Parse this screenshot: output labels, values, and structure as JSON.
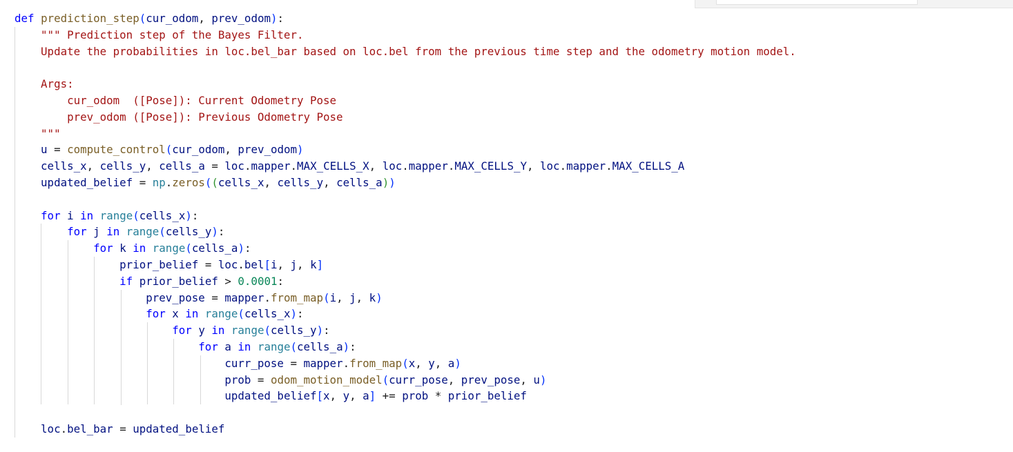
{
  "code_lines": [
    [
      [
        "kw",
        "def"
      ],
      [
        "pn",
        " "
      ],
      [
        "fn",
        "prediction_step"
      ],
      [
        "br1",
        "("
      ],
      [
        "var",
        "cur_odom"
      ],
      [
        "pn",
        ", "
      ],
      [
        "var",
        "prev_odom"
      ],
      [
        "br1",
        ")"
      ],
      [
        "pn",
        ":"
      ]
    ],
    [
      [
        "pn",
        "    "
      ],
      [
        "str",
        "\"\"\" Prediction step of the Bayes Filter."
      ]
    ],
    [
      [
        "str",
        "    Update the probabilities in loc.bel_bar based on loc.bel from the previous time step and the odometry motion model."
      ]
    ],
    [],
    [
      [
        "str",
        "    Args:"
      ]
    ],
    [
      [
        "str",
        "        cur_odom  ([Pose]): Current Odometry Pose"
      ]
    ],
    [
      [
        "str",
        "        prev_odom ([Pose]): Previous Odometry Pose"
      ]
    ],
    [
      [
        "str",
        "    \"\"\""
      ]
    ],
    [
      [
        "pn",
        "    "
      ],
      [
        "var",
        "u"
      ],
      [
        "op",
        " = "
      ],
      [
        "fn",
        "compute_control"
      ],
      [
        "br1",
        "("
      ],
      [
        "var",
        "cur_odom"
      ],
      [
        "pn",
        ", "
      ],
      [
        "var",
        "prev_odom"
      ],
      [
        "br1",
        ")"
      ]
    ],
    [
      [
        "pn",
        "    "
      ],
      [
        "var",
        "cells_x"
      ],
      [
        "pn",
        ", "
      ],
      [
        "var",
        "cells_y"
      ],
      [
        "pn",
        ", "
      ],
      [
        "var",
        "cells_a"
      ],
      [
        "op",
        " = "
      ],
      [
        "var",
        "loc"
      ],
      [
        "pn",
        "."
      ],
      [
        "var",
        "mapper"
      ],
      [
        "pn",
        "."
      ],
      [
        "var",
        "MAX_CELLS_X"
      ],
      [
        "pn",
        ", "
      ],
      [
        "var",
        "loc"
      ],
      [
        "pn",
        "."
      ],
      [
        "var",
        "mapper"
      ],
      [
        "pn",
        "."
      ],
      [
        "var",
        "MAX_CELLS_Y"
      ],
      [
        "pn",
        ", "
      ],
      [
        "var",
        "loc"
      ],
      [
        "pn",
        "."
      ],
      [
        "var",
        "mapper"
      ],
      [
        "pn",
        "."
      ],
      [
        "var",
        "MAX_CELLS_A"
      ]
    ],
    [
      [
        "pn",
        "    "
      ],
      [
        "var",
        "updated_belief"
      ],
      [
        "op",
        " = "
      ],
      [
        "mod",
        "np"
      ],
      [
        "pn",
        "."
      ],
      [
        "fn",
        "zeros"
      ],
      [
        "br1",
        "("
      ],
      [
        "br2",
        "("
      ],
      [
        "var",
        "cells_x"
      ],
      [
        "pn",
        ", "
      ],
      [
        "var",
        "cells_y"
      ],
      [
        "pn",
        ", "
      ],
      [
        "var",
        "cells_a"
      ],
      [
        "br2",
        ")"
      ],
      [
        "br1",
        ")"
      ]
    ],
    [],
    [
      [
        "pn",
        "    "
      ],
      [
        "kw",
        "for"
      ],
      [
        "pn",
        " "
      ],
      [
        "var",
        "i"
      ],
      [
        "pn",
        " "
      ],
      [
        "kw",
        "in"
      ],
      [
        "pn",
        " "
      ],
      [
        "mod",
        "range"
      ],
      [
        "br1",
        "("
      ],
      [
        "var",
        "cells_x"
      ],
      [
        "br1",
        ")"
      ],
      [
        "pn",
        ":"
      ]
    ],
    [
      [
        "pn",
        "        "
      ],
      [
        "kw",
        "for"
      ],
      [
        "pn",
        " "
      ],
      [
        "var",
        "j"
      ],
      [
        "pn",
        " "
      ],
      [
        "kw",
        "in"
      ],
      [
        "pn",
        " "
      ],
      [
        "mod",
        "range"
      ],
      [
        "br1",
        "("
      ],
      [
        "var",
        "cells_y"
      ],
      [
        "br1",
        ")"
      ],
      [
        "pn",
        ":"
      ]
    ],
    [
      [
        "pn",
        "            "
      ],
      [
        "kw",
        "for"
      ],
      [
        "pn",
        " "
      ],
      [
        "var",
        "k"
      ],
      [
        "pn",
        " "
      ],
      [
        "kw",
        "in"
      ],
      [
        "pn",
        " "
      ],
      [
        "mod",
        "range"
      ],
      [
        "br1",
        "("
      ],
      [
        "var",
        "cells_a"
      ],
      [
        "br1",
        ")"
      ],
      [
        "pn",
        ":"
      ]
    ],
    [
      [
        "pn",
        "                "
      ],
      [
        "var",
        "prior_belief"
      ],
      [
        "op",
        " = "
      ],
      [
        "var",
        "loc"
      ],
      [
        "pn",
        "."
      ],
      [
        "var",
        "bel"
      ],
      [
        "br1",
        "["
      ],
      [
        "var",
        "i"
      ],
      [
        "pn",
        ", "
      ],
      [
        "var",
        "j"
      ],
      [
        "pn",
        ", "
      ],
      [
        "var",
        "k"
      ],
      [
        "br1",
        "]"
      ]
    ],
    [
      [
        "pn",
        "                "
      ],
      [
        "kw",
        "if"
      ],
      [
        "pn",
        " "
      ],
      [
        "var",
        "prior_belief"
      ],
      [
        "op",
        " > "
      ],
      [
        "num",
        "0.0001"
      ],
      [
        "pn",
        ":"
      ]
    ],
    [
      [
        "pn",
        "                    "
      ],
      [
        "var",
        "prev_pose"
      ],
      [
        "op",
        " = "
      ],
      [
        "var",
        "mapper"
      ],
      [
        "pn",
        "."
      ],
      [
        "fn",
        "from_map"
      ],
      [
        "br1",
        "("
      ],
      [
        "var",
        "i"
      ],
      [
        "pn",
        ", "
      ],
      [
        "var",
        "j"
      ],
      [
        "pn",
        ", "
      ],
      [
        "var",
        "k"
      ],
      [
        "br1",
        ")"
      ]
    ],
    [
      [
        "pn",
        "                    "
      ],
      [
        "kw",
        "for"
      ],
      [
        "pn",
        " "
      ],
      [
        "var",
        "x"
      ],
      [
        "pn",
        " "
      ],
      [
        "kw",
        "in"
      ],
      [
        "pn",
        " "
      ],
      [
        "mod",
        "range"
      ],
      [
        "br1",
        "("
      ],
      [
        "var",
        "cells_x"
      ],
      [
        "br1",
        ")"
      ],
      [
        "pn",
        ":"
      ]
    ],
    [
      [
        "pn",
        "                        "
      ],
      [
        "kw",
        "for"
      ],
      [
        "pn",
        " "
      ],
      [
        "var",
        "y"
      ],
      [
        "pn",
        " "
      ],
      [
        "kw",
        "in"
      ],
      [
        "pn",
        " "
      ],
      [
        "mod",
        "range"
      ],
      [
        "br1",
        "("
      ],
      [
        "var",
        "cells_y"
      ],
      [
        "br1",
        ")"
      ],
      [
        "pn",
        ":"
      ]
    ],
    [
      [
        "pn",
        "                            "
      ],
      [
        "kw",
        "for"
      ],
      [
        "pn",
        " "
      ],
      [
        "var",
        "a"
      ],
      [
        "pn",
        " "
      ],
      [
        "kw",
        "in"
      ],
      [
        "pn",
        " "
      ],
      [
        "mod",
        "range"
      ],
      [
        "br1",
        "("
      ],
      [
        "var",
        "cells_a"
      ],
      [
        "br1",
        ")"
      ],
      [
        "pn",
        ":"
      ]
    ],
    [
      [
        "pn",
        "                                "
      ],
      [
        "var",
        "curr_pose"
      ],
      [
        "op",
        " = "
      ],
      [
        "var",
        "mapper"
      ],
      [
        "pn",
        "."
      ],
      [
        "fn",
        "from_map"
      ],
      [
        "br1",
        "("
      ],
      [
        "var",
        "x"
      ],
      [
        "pn",
        ", "
      ],
      [
        "var",
        "y"
      ],
      [
        "pn",
        ", "
      ],
      [
        "var",
        "a"
      ],
      [
        "br1",
        ")"
      ]
    ],
    [
      [
        "pn",
        "                                "
      ],
      [
        "var",
        "prob"
      ],
      [
        "op",
        " = "
      ],
      [
        "fn",
        "odom_motion_model"
      ],
      [
        "br1",
        "("
      ],
      [
        "var",
        "curr_pose"
      ],
      [
        "pn",
        ", "
      ],
      [
        "var",
        "prev_pose"
      ],
      [
        "pn",
        ", "
      ],
      [
        "var",
        "u"
      ],
      [
        "br1",
        ")"
      ]
    ],
    [
      [
        "pn",
        "                                "
      ],
      [
        "var",
        "updated_belief"
      ],
      [
        "br1",
        "["
      ],
      [
        "var",
        "x"
      ],
      [
        "pn",
        ", "
      ],
      [
        "var",
        "y"
      ],
      [
        "pn",
        ", "
      ],
      [
        "var",
        "a"
      ],
      [
        "br1",
        "]"
      ],
      [
        "op",
        " += "
      ],
      [
        "var",
        "prob"
      ],
      [
        "op",
        " * "
      ],
      [
        "var",
        "prior_belief"
      ]
    ],
    [],
    [
      [
        "pn",
        "    "
      ],
      [
        "var",
        "loc"
      ],
      [
        "pn",
        "."
      ],
      [
        "var",
        "bel_bar"
      ],
      [
        "op",
        " = "
      ],
      [
        "var",
        "updated_belief"
      ]
    ]
  ],
  "colors": {
    "keyword": "#0000ff",
    "function": "#795e26",
    "string": "#a31515",
    "number": "#098658",
    "variable": "#001080",
    "builtin": "#267f99",
    "bracket_level1": "#0431fa",
    "bracket_level2": "#319331",
    "indent_guide": "#d8d8d8"
  }
}
